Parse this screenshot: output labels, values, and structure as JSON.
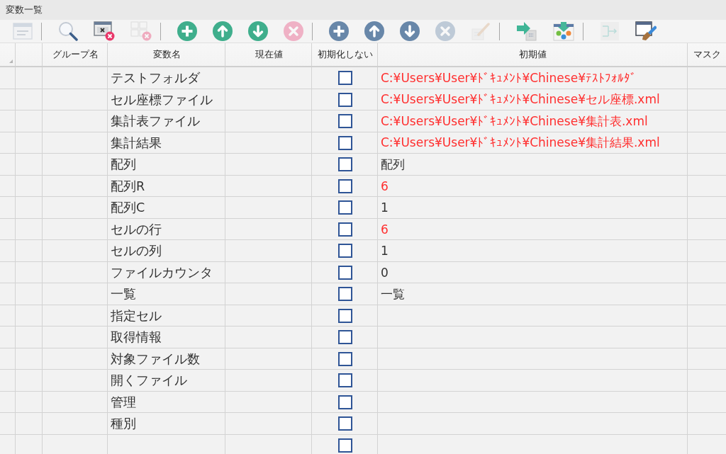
{
  "window": {
    "title": "変数一覧"
  },
  "toolbar": {
    "groups": [
      [
        {
          "disabled": true
        }
      ],
      [
        {
          "disabled": false
        },
        {
          "disabled": false
        },
        {
          "disabled": true
        }
      ],
      [
        {
          "disabled": false
        },
        {
          "disabled": false
        },
        {
          "disabled": false
        },
        {
          "disabled": true
        }
      ],
      [
        {
          "disabled": false
        },
        {
          "disabled": false
        },
        {
          "disabled": false
        },
        {
          "disabled": true
        },
        {
          "disabled": true
        }
      ],
      [
        {
          "disabled": false
        },
        {
          "disabled": false
        }
      ],
      [
        {
          "disabled": true
        },
        {
          "disabled": false
        }
      ]
    ]
  },
  "table": {
    "columns": [
      "グループ名",
      "変数名",
      "現在値",
      "初期化しない",
      "初期値",
      "マスク"
    ],
    "rows": [
      {
        "name": "テストフォルダ",
        "checked": false,
        "initial_value": "C:¥Users¥User¥ﾄﾞｷｭﾒﾝﾄ¥Chinese¥ﾃｽﾄﾌｫﾙﾀﾞ",
        "highlighted": true
      },
      {
        "name": "セル座標ファイル",
        "checked": false,
        "initial_value": "C:¥Users¥User¥ﾄﾞｷｭﾒﾝﾄ¥Chinese¥セル座標.xml",
        "highlighted": true
      },
      {
        "name": "集計表ファイル",
        "checked": false,
        "initial_value": "C:¥Users¥User¥ﾄﾞｷｭﾒﾝﾄ¥Chinese¥集計表.xml",
        "highlighted": true
      },
      {
        "name": "集計結果",
        "checked": false,
        "initial_value": "C:¥Users¥User¥ﾄﾞｷｭﾒﾝﾄ¥Chinese¥集計結果.xml",
        "highlighted": true
      },
      {
        "name": "配列",
        "checked": false,
        "initial_value": "配列",
        "highlighted": false
      },
      {
        "name": "配列R",
        "checked": false,
        "initial_value": "6",
        "highlighted": true
      },
      {
        "name": "配列C",
        "checked": false,
        "initial_value": "1",
        "highlighted": false
      },
      {
        "name": "セルの行",
        "checked": false,
        "initial_value": "6",
        "highlighted": true
      },
      {
        "name": "セルの列",
        "checked": false,
        "initial_value": "1",
        "highlighted": false
      },
      {
        "name": "ファイルカウンタ",
        "checked": false,
        "initial_value": "0",
        "highlighted": false
      },
      {
        "name": "一覧",
        "checked": false,
        "initial_value": "一覧",
        "highlighted": false
      },
      {
        "name": "指定セル",
        "checked": false
      },
      {
        "name": "取得情報",
        "checked": false
      },
      {
        "name": "対象ファイル数",
        "checked": false
      },
      {
        "name": "開くファイル",
        "checked": false
      },
      {
        "name": "管理",
        "checked": false
      },
      {
        "name": "種別",
        "checked": false
      },
      {
        "checked": false
      }
    ]
  }
}
